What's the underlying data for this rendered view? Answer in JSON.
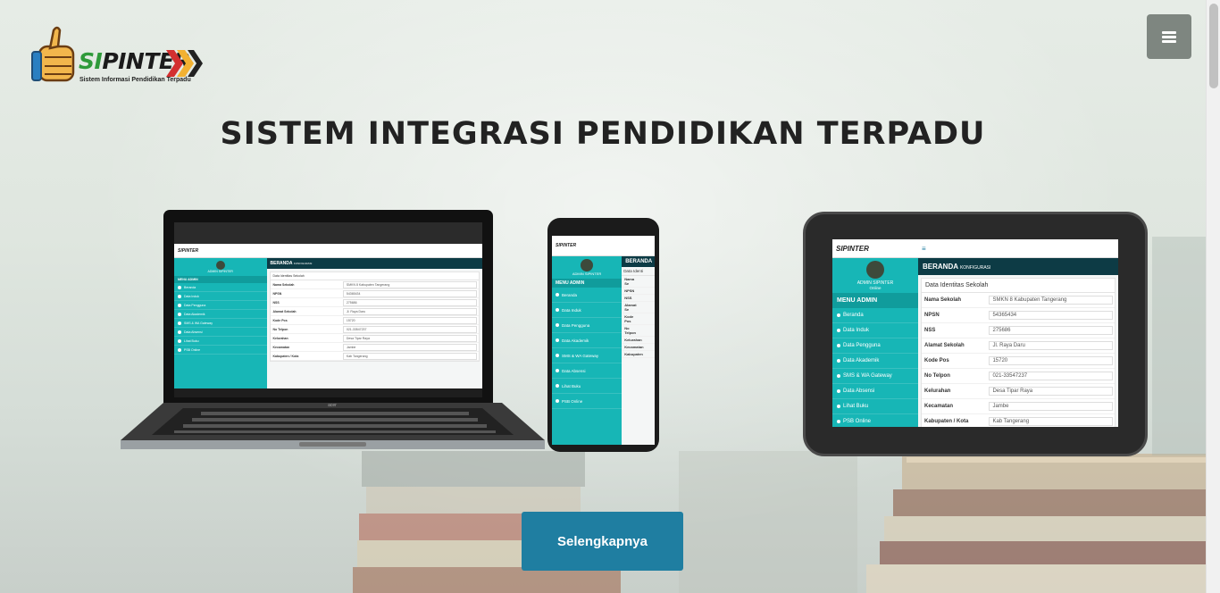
{
  "logo": {
    "title_si": "SI",
    "title_pinter": "PINTER",
    "subtitle": "Sistem Informasi Pendidikan Terpadu"
  },
  "menu_button": {
    "icon": "hamburger-icon"
  },
  "hero": {
    "title": "SISTEM INTEGRASI PENDIDIKAN TERPADU"
  },
  "cta": {
    "label": "Selengkapnya"
  },
  "colors": {
    "accent": "#1f7ea1",
    "sidebar": "#17b6b6",
    "header_dark": "#0d3b45",
    "menu_button": "#7e8680"
  },
  "tablet_app": {
    "brand": "SIPINTER",
    "user_name": "ADMIN SIPINTER",
    "user_status": "Online",
    "menu_title": "MENU ADMIN",
    "header": "BERANDA",
    "header_sub": "KONFIGURASI",
    "panel_title": "Data Identitas Sekolah",
    "menu_items": [
      "Beranda",
      "Data Induk",
      "Data Pengguna",
      "Data Akademik",
      "SMS & WA Gateway",
      "Data Absensi",
      "Lihat Buku",
      "PSB Online"
    ],
    "fields": [
      {
        "k": "Nama Sekolah",
        "v": "SMKN 8 Kabupaten Tangerang"
      },
      {
        "k": "NPSN",
        "v": "54365434"
      },
      {
        "k": "NSS",
        "v": "275686"
      },
      {
        "k": "Alamat Sekolah",
        "v": "Jl. Raya Daru"
      },
      {
        "k": "Kode Pos",
        "v": "15720"
      },
      {
        "k": "No Telpon",
        "v": "021-33547237"
      },
      {
        "k": "Kelurahan",
        "v": "Desa Tipar Raya"
      },
      {
        "k": "Kecamatan",
        "v": "Jambe"
      },
      {
        "k": "Kabupaten / Kota",
        "v": "Kab Tangerang"
      }
    ]
  },
  "phone_app": {
    "brand": "SIPINTER",
    "user_name": "ADMIN SIPINTER",
    "menu_title": "MENU ADMIN",
    "header": "BERANDA",
    "panel_title": "Data Identi",
    "menu_items": [
      "Beranda",
      "Data Induk",
      "Data Pengguna",
      "Data Akademik",
      "SMS & WA Gateway",
      "Data Absensi",
      "Lihat Buku",
      "PSB Online"
    ],
    "fields": [
      "Nama Se",
      "NPSN",
      "NSS",
      "Alamat Se",
      "Kode Pos",
      "No Telpon",
      "Kelurahan",
      "Kecamatan",
      "Kabupaten"
    ]
  },
  "laptop_app": {
    "brand": "SIPINTER",
    "user_name": "ADMIN SIPINTER",
    "menu_title": "MENU ADMIN",
    "header": "BERANDA",
    "header_sub": "KONFIGURASI",
    "panel_title": "Data Identitas Sekolah",
    "menu_items": [
      "Beranda",
      "Data Induk",
      "Data Pengguna",
      "Data Akademik",
      "SMS & WA Gateway",
      "Data Absensi",
      "Lihat Buku",
      "PSB Online"
    ],
    "fields": [
      {
        "k": "Nama Sekolah",
        "v": "SMKN 8 Kabupaten Tangerang"
      },
      {
        "k": "NPSN",
        "v": "54365434"
      },
      {
        "k": "NSS",
        "v": "275686"
      },
      {
        "k": "Alamat Sekolah",
        "v": "Jl. Raya Daru"
      },
      {
        "k": "Kode Pos",
        "v": "15720"
      },
      {
        "k": "No Telpon",
        "v": "021-33547237"
      },
      {
        "k": "Kelurahan",
        "v": "Desa Tipar Raya"
      },
      {
        "k": "Kecamatan",
        "v": "Jambe"
      },
      {
        "k": "Kabupaten / Kota",
        "v": "Kab Tangerang"
      }
    ],
    "laptop_brand": "acer"
  }
}
